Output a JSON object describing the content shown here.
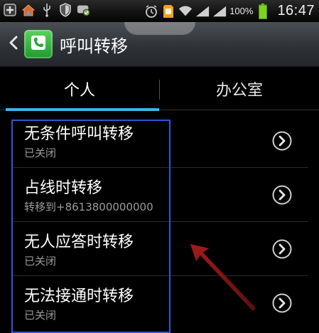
{
  "status_bar": {
    "battery_percent": "100%",
    "time": "16:47",
    "icons": [
      "plus-box-icon",
      "home-icon",
      "usb-icon",
      "shield-icon",
      "message-icon",
      "alarm-icon",
      "sd-card-icon",
      "wifi-icon",
      "signal-icon",
      "sim-icon",
      "battery-icon"
    ]
  },
  "action_bar": {
    "title": "呼叫转移",
    "back_icon": "chevron-left-icon",
    "app_icon": "phone-icon"
  },
  "tabs": [
    {
      "label": "个人",
      "selected": true
    },
    {
      "label": "办公室",
      "selected": false
    }
  ],
  "list": {
    "items": [
      {
        "title": "无条件呼叫转移",
        "subtitle": "已关闭"
      },
      {
        "title": "占线时转移",
        "subtitle": "转移到+8613800000000"
      },
      {
        "title": "无人应答时转移",
        "subtitle": "已关闭"
      },
      {
        "title": "无法接通时转移",
        "subtitle": "已关闭"
      }
    ]
  },
  "colors": {
    "accent": "#39b6e6",
    "highlight_box": "#2f56d8",
    "arrow": "#8b1a1a"
  }
}
